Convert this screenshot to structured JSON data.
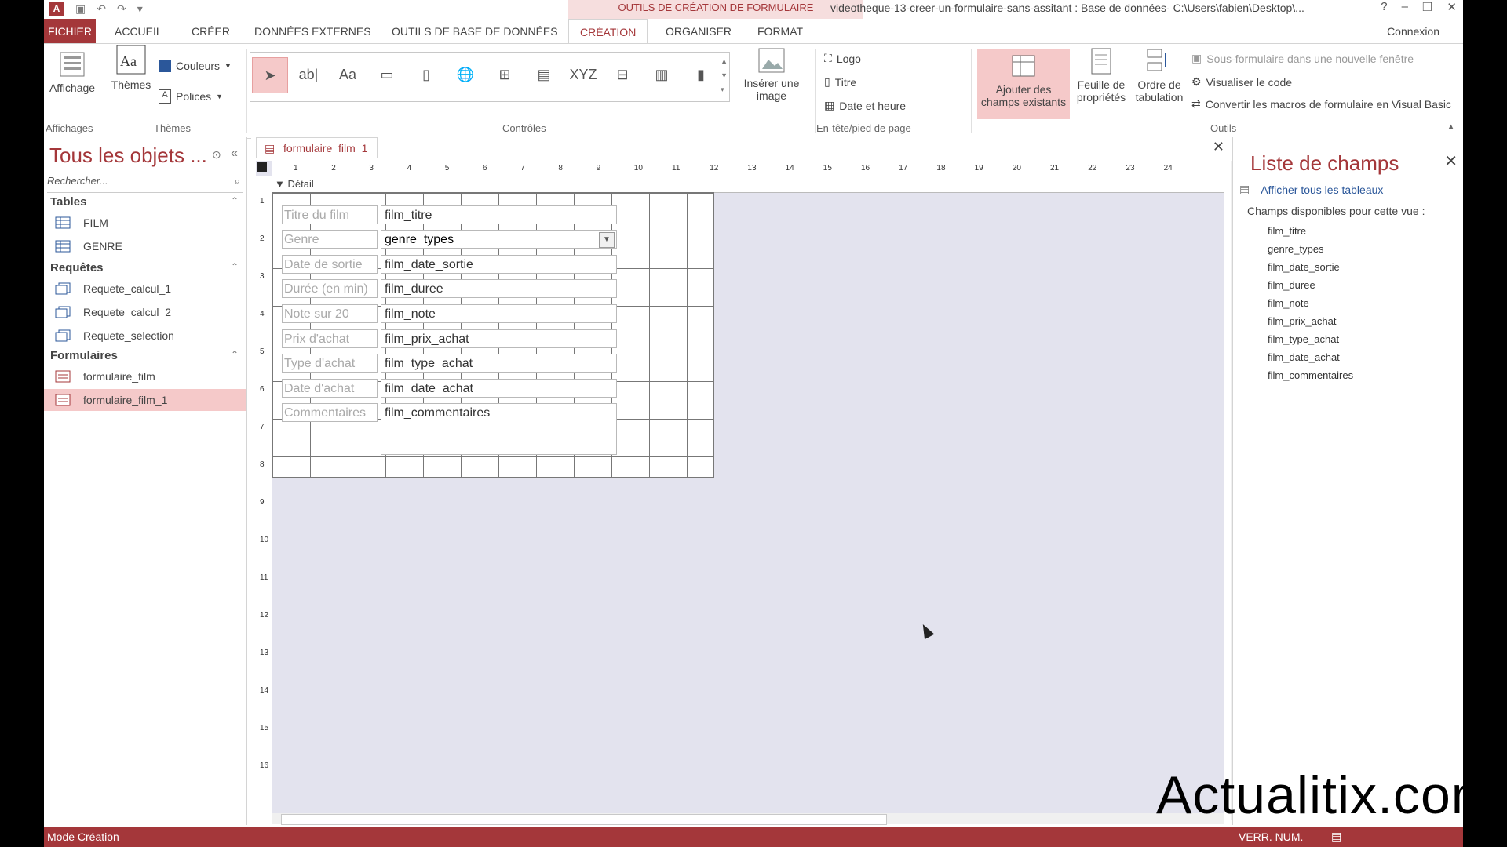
{
  "window": {
    "contextual_tab_group": "OUTILS DE CRÉATION DE FORMULAIRE",
    "title": "videotheque-13-creer-un-formulaire-sans-assitant : Base de données- C:\\Users\\fabien\\Desktop\\...",
    "help": "?",
    "minimize": "–",
    "restore": "❐",
    "close": "✕",
    "app_logo": "A"
  },
  "tabs": {
    "file": "FICHIER",
    "home": "ACCUEIL",
    "create": "CRÉER",
    "external": "DONNÉES EXTERNES",
    "dbtools": "OUTILS DE BASE DE DONNÉES",
    "design": "CRÉATION",
    "arrange": "ORGANISER",
    "format": "FORMAT",
    "signin": "Connexion"
  },
  "ribbon": {
    "views": {
      "button": "Affichage",
      "group": "Affichages"
    },
    "themes": {
      "button": "Thèmes",
      "colors": "Couleurs",
      "fonts": "Polices",
      "group": "Thèmes"
    },
    "controls": {
      "group": "Contrôles",
      "insert_image": "Insérer une image"
    },
    "header_footer": {
      "logo": "Logo",
      "title": "Titre",
      "date_time": "Date et heure",
      "group": "En-tête/pied de page"
    },
    "tools": {
      "add_fields": "Ajouter des champs existants",
      "property_sheet": "Feuille de propriétés",
      "tab_order": "Ordre de tabulation",
      "subform_window": "Sous-formulaire dans une nouvelle fenêtre",
      "view_code": "Visualiser le code",
      "convert_macros": "Convertir les macros de formulaire en Visual Basic",
      "group": "Outils"
    }
  },
  "nav": {
    "title": "Tous les objets ...",
    "search_placeholder": "Rechercher...",
    "sections": [
      {
        "label": "Tables",
        "items": [
          "FILM",
          "GENRE"
        ]
      },
      {
        "label": "Requêtes",
        "items": [
          "Requete_calcul_1",
          "Requete_calcul_2",
          "Requete_selection"
        ]
      },
      {
        "label": "Formulaires",
        "items": [
          "formulaire_film",
          "formulaire_film_1"
        ]
      }
    ]
  },
  "document": {
    "tab": "formulaire_film_1",
    "section": "Détail",
    "ruler_numbers": [
      "1",
      "2",
      "3",
      "4",
      "5",
      "6",
      "7",
      "8",
      "9",
      "10",
      "11",
      "12",
      "13",
      "14",
      "15",
      "16",
      "17",
      "18",
      "19",
      "20",
      "21",
      "22",
      "23",
      "24"
    ],
    "vruler_numbers": [
      "1",
      "2",
      "3",
      "4",
      "5",
      "6",
      "7",
      "8",
      "9",
      "10",
      "11",
      "12",
      "13",
      "14",
      "15",
      "16"
    ],
    "labels": [
      "Titre du film",
      "Genre",
      "Date de sortie",
      "Durée (en min)",
      "Note sur 20",
      "Prix d'achat",
      "Type d'achat",
      "Date d'achat",
      "Commentaires"
    ],
    "fields": [
      "film_titre",
      "genre_types",
      "film_date_sortie",
      "film_duree",
      "film_note",
      "film_prix_achat",
      "film_type_achat",
      "film_date_achat",
      "film_commentaires"
    ]
  },
  "field_list": {
    "title": "Liste de champs",
    "show_all": "Afficher tous les tableaux",
    "subtitle": "Champs disponibles pour cette vue :",
    "fields": [
      "film_titre",
      "genre_types",
      "film_date_sortie",
      "film_duree",
      "film_note",
      "film_prix_achat",
      "film_type_achat",
      "film_date_achat",
      "film_commentaires"
    ]
  },
  "status": {
    "mode": "Mode Création",
    "numlock": "VERR. NUM."
  },
  "watermark": "Actualitix.com",
  "colors": {
    "accent": "#a4373a",
    "selected": "#f5c9c9"
  }
}
